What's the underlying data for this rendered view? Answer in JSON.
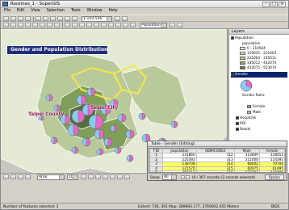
{
  "window": {
    "title": "Routines_1 - SuperGIS"
  },
  "menu": [
    "File",
    "Edit",
    "View",
    "Selection",
    "Tools",
    "Window",
    "Help"
  ],
  "toolbar": {
    "scale_value": "1:150,556",
    "layer_dropdown": "Population"
  },
  "map": {
    "title": "Gender and Population Distribution",
    "labels": {
      "taipei_city": "Taipei City",
      "taipei_county": "Taipei County"
    },
    "colors": {
      "water": "#c9c6c0",
      "land_light": "#e4ead4",
      "land_mid": "#b9c99a",
      "land_dark": "#7f9e5a",
      "land_darkest": "#53703a",
      "outline": "#f3e74a",
      "pie_male": "#8cc9ef",
      "pie_female": "#e36ac8"
    }
  },
  "layers": {
    "header": "Layers",
    "population_layer": "Population",
    "population_field": "population",
    "legend": [
      {
        "label": "0 - 110924",
        "color": "#eef2e0"
      },
      {
        "label": "110925 - 221003",
        "color": "#d5e2b6"
      },
      {
        "label": "221004 - 335011",
        "color": "#b3c98d"
      },
      {
        "label": "335012 - 442074",
        "color": "#86a865"
      },
      {
        "label": "442075 - 553074",
        "color": "#58763f"
      }
    ],
    "gender_layer": "Gender",
    "gender_ratio_label": "Gender Ratio",
    "gender_legend": [
      {
        "label": "Female",
        "color": "#e36ac8"
      },
      {
        "label": "Male",
        "color": "#8cc9ef"
      }
    ],
    "other_layers": [
      "Hospitals",
      "POI",
      "Roads"
    ]
  },
  "attribute_table": {
    "title": "Table - Gender (Editing)",
    "columns": [
      "FID",
      "population",
      "ADMICODE2",
      "Male",
      "Female"
    ],
    "rows": [
      {
        "fid": "1",
        "population": "231860",
        "admicode": "312",
        "male": "113849",
        "female": "118011",
        "highlight": false
      },
      {
        "fid": "2",
        "population": "225392",
        "admicode": "313",
        "male": "111000",
        "female": "114392",
        "highlight": false
      },
      {
        "fid": "3",
        "population": "138708",
        "admicode": "314",
        "male": "68002",
        "female": "70706",
        "highlight": true
      },
      {
        "fid": "4",
        "population": "121570",
        "admicode": "315",
        "male": "60075",
        "female": "61495",
        "highlight": true
      },
      {
        "fid": "5",
        "population": "256112",
        "admicode": "316",
        "male": "127703",
        "female": "128409",
        "highlight": false
      },
      {
        "fid": "6",
        "population": "199765",
        "admicode": "317",
        "male": "97804",
        "female": "101961",
        "highlight": false
      }
    ],
    "show_label": "Show:",
    "show_value": "All",
    "record_info": "(0 / 367 records) (2 records selected)",
    "options_button": "Option"
  },
  "bottom_toolbar": {
    "font_value": "Arial",
    "size_value": "10"
  },
  "status": {
    "left_text": "Number of features selected: 1",
    "right_text": "Extent: 730, 391  Map: 289993.177, 2769002.455 Meters",
    "right_num": "BIDE"
  }
}
